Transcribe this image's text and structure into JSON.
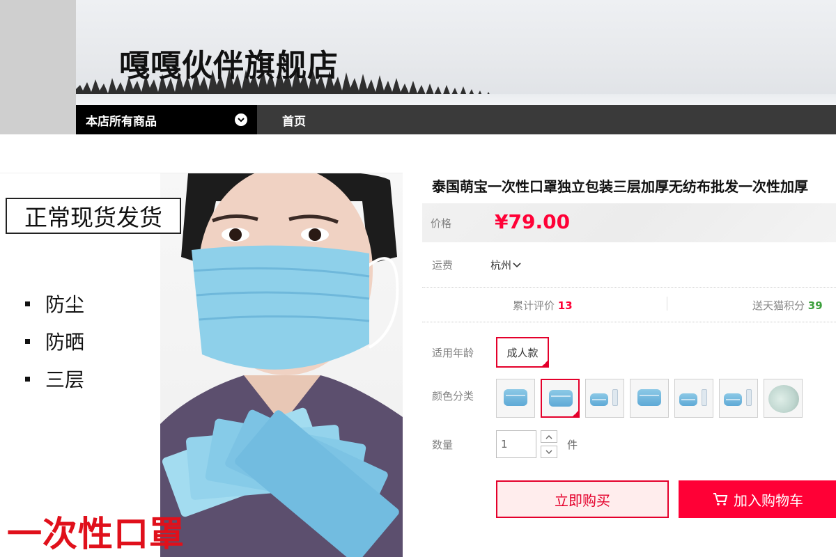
{
  "header": {
    "shop_name": "嘎嘎伙伴旗舰店",
    "nav_all": "本店所有商品",
    "nav_home": "首页"
  },
  "product_image": {
    "stamp": "正常现货发货",
    "features": [
      "防尘",
      "防晒",
      "三层"
    ],
    "big_title": "一次性口罩"
  },
  "product": {
    "title": "泰国萌宝一次性口罩独立包装三层加厚无纺布批发一次性加厚",
    "price_label": "价格",
    "price": "¥79.00",
    "shipping_label": "运费",
    "shipping_from": "杭州",
    "reviews_label": "累计评价",
    "reviews_count": "13",
    "points_label": "送天猫积分",
    "points_count": "39",
    "age_label": "适用年龄",
    "age_option": "成人款",
    "color_label": "颜色分类",
    "qty_label": "数量",
    "qty_value": "1",
    "qty_unit": "件",
    "buy_now": "立即购买",
    "add_to_cart": "加入购物车"
  },
  "colors": {
    "accent": "#ff0036",
    "nav_bg": "#3a3a3a",
    "points_green": "#3c9f3c"
  }
}
